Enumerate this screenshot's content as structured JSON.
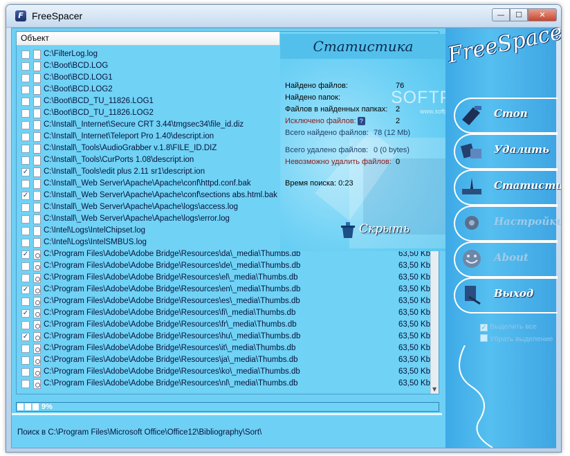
{
  "window": {
    "title": "FreeSpacer",
    "minimize_label": "—",
    "maximize_label": "☐",
    "close_label": "✕"
  },
  "list": {
    "header": "Объект",
    "rows": [
      {
        "checked": false,
        "path": "C:\\FilterLog.log",
        "size": ""
      },
      {
        "checked": false,
        "path": "C:\\Boot\\BCD.LOG",
        "size": ""
      },
      {
        "checked": false,
        "path": "C:\\Boot\\BCD.LOG1",
        "size": ""
      },
      {
        "checked": false,
        "path": "C:\\Boot\\BCD.LOG2",
        "size": ""
      },
      {
        "checked": false,
        "path": "C:\\Boot\\BCD_TU_11826.LOG1",
        "size": ""
      },
      {
        "checked": false,
        "path": "C:\\Boot\\BCD_TU_11826.LOG2",
        "size": ""
      },
      {
        "checked": false,
        "path": "C:\\Install\\_Internet\\Secure CRT 3.44\\tmgsec34\\file_id.diz",
        "size": ""
      },
      {
        "checked": false,
        "path": "C:\\Install\\_Internet\\Teleport Pro 1.40\\descript.ion",
        "size": ""
      },
      {
        "checked": false,
        "path": "C:\\Install\\_Tools\\AudioGrabber v.1.8\\FILE_ID.DIZ",
        "size": ""
      },
      {
        "checked": false,
        "path": "C:\\Install\\_Tools\\CurPorts 1.08\\descript.ion",
        "size": ""
      },
      {
        "checked": true,
        "path": "C:\\Install\\_Tools\\edit plus 2.11 sr1\\descript.ion",
        "size": ""
      },
      {
        "checked": false,
        "path": "C:\\Install\\_Web Server\\Apache\\Apache\\conf\\httpd.conf.bak",
        "size": ""
      },
      {
        "checked": true,
        "path": "C:\\Install\\_Web Server\\Apache\\Apache\\conf\\sections abs.html.bak",
        "size": ""
      },
      {
        "checked": false,
        "path": "C:\\Install\\_Web Server\\Apache\\Apache\\logs\\access.log",
        "size": ""
      },
      {
        "checked": false,
        "path": "C:\\Install\\_Web Server\\Apache\\Apache\\logs\\error.log",
        "size": ""
      },
      {
        "checked": false,
        "path": "C:\\Intel\\Logs\\IntelChipset.log",
        "size": ""
      },
      {
        "checked": false,
        "path": "C:\\Intel\\Logs\\IntelSMBUS.log",
        "size": ""
      },
      {
        "checked": true,
        "path": "C:\\Program Files\\Adobe\\Adobe Bridge\\Resources\\da\\_media\\Thumbs.db",
        "size": "63,50 Kb"
      },
      {
        "checked": false,
        "path": "C:\\Program Files\\Adobe\\Adobe Bridge\\Resources\\de\\_media\\Thumbs.db",
        "size": "63,50 Kb"
      },
      {
        "checked": false,
        "path": "C:\\Program Files\\Adobe\\Adobe Bridge\\Resources\\el\\_media\\Thumbs.db",
        "size": "63,50 Kb"
      },
      {
        "checked": true,
        "path": "C:\\Program Files\\Adobe\\Adobe Bridge\\Resources\\en\\_media\\Thumbs.db",
        "size": "63,50 Kb"
      },
      {
        "checked": false,
        "path": "C:\\Program Files\\Adobe\\Adobe Bridge\\Resources\\es\\_media\\Thumbs.db",
        "size": "63,50 Kb"
      },
      {
        "checked": true,
        "path": "C:\\Program Files\\Adobe\\Adobe Bridge\\Resources\\fi\\_media\\Thumbs.db",
        "size": "63,50 Kb"
      },
      {
        "checked": false,
        "path": "C:\\Program Files\\Adobe\\Adobe Bridge\\Resources\\fr\\_media\\Thumbs.db",
        "size": "63,50 Kb"
      },
      {
        "checked": true,
        "path": "C:\\Program Files\\Adobe\\Adobe Bridge\\Resources\\hu\\_media\\Thumbs.db",
        "size": "63,50 Kb"
      },
      {
        "checked": false,
        "path": "C:\\Program Files\\Adobe\\Adobe Bridge\\Resources\\it\\_media\\Thumbs.db",
        "size": "63,50 Kb"
      },
      {
        "checked": false,
        "path": "C:\\Program Files\\Adobe\\Adobe Bridge\\Resources\\ja\\_media\\Thumbs.db",
        "size": "63,50 Kb"
      },
      {
        "checked": false,
        "path": "C:\\Program Files\\Adobe\\Adobe Bridge\\Resources\\ko\\_media\\Thumbs.db",
        "size": "63,50 Kb"
      },
      {
        "checked": false,
        "path": "C:\\Program Files\\Adobe\\Adobe Bridge\\Resources\\nl\\_media\\Thumbs.db",
        "size": "63,50 Kb"
      }
    ]
  },
  "stats": {
    "title": "Статистика",
    "found_files_label": "Найдено файлов:",
    "found_files_value": "76",
    "found_folders_label": "Найдено папок:",
    "found_folders_value": "",
    "files_in_folders_label": "Файлов в найденных папках:",
    "files_in_folders_value": "2",
    "excluded_label": "Исключено файлов:",
    "excluded_value": "2",
    "total_found_label": "Всего найдено файлов:",
    "total_found_value": "78 (12 Mb)",
    "total_deleted_label": "Всего удалено файлов:",
    "total_deleted_value": "0 (0 bytes)",
    "cannot_delete_label": "Невозможно удалить файлов:",
    "cannot_delete_value": "0",
    "search_time_label": "Время поиска:",
    "search_time_value": "0:23",
    "hide_label": "Скрыть"
  },
  "watermark": {
    "text": "SOFTPORTAL",
    "url": "www.softportal.com"
  },
  "sidebar": {
    "logo": "FreeSpacer",
    "buttons": [
      {
        "label": "Стоп",
        "icon": "phone-stop-icon"
      },
      {
        "label": "Удалить",
        "icon": "delete-icon"
      },
      {
        "label": "Статистика",
        "icon": "statistics-icon"
      },
      {
        "label": "Настройки",
        "icon": "settings-icon"
      },
      {
        "label": "About",
        "icon": "about-icon"
      },
      {
        "label": "Выход",
        "icon": "exit-icon"
      }
    ],
    "select_all_label": "Выделить все",
    "deselect_label": "Убрать выделение"
  },
  "progress": {
    "value": 0.09,
    "text": "9%"
  },
  "status": {
    "text": "Поиск в C:\\Program Files\\Microsoft Office\\Office12\\Bibliography\\Sort\\"
  },
  "colors": {
    "client_bg": "#6fd0f5",
    "sidebar_bg": "#3da9e6",
    "text": "#05123a"
  }
}
